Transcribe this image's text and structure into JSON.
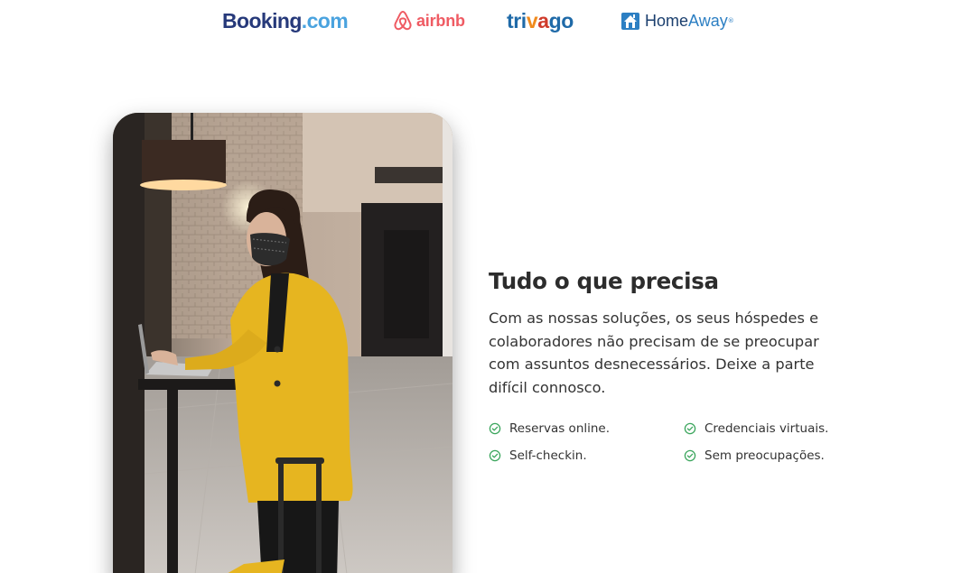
{
  "partners": {
    "booking": {
      "part1": "Booking",
      "part2": ".com"
    },
    "airbnb": {
      "label": "airbnb"
    },
    "trivago": {
      "tri": "tri",
      "v": "v",
      "a": "a",
      "go": "go"
    },
    "homeaway": {
      "part1": "Home",
      "part2": "Away",
      "tm": "®"
    }
  },
  "section": {
    "title": "Tudo o que precisa",
    "description": "Com as nossas soluções, os seus hóspedes e colaboradores não precisam de se preocupar com assuntos desnecessários. Deixe a parte difícil connosco.",
    "features": [
      {
        "label": "Reservas online.",
        "icon": "check-circle-icon"
      },
      {
        "label": "Credenciais virtuais.",
        "icon": "check-circle-icon"
      },
      {
        "label": "Self-checkin.",
        "icon": "check-circle-icon"
      },
      {
        "label": "Sem preocupações.",
        "icon": "check-circle-icon"
      }
    ]
  },
  "colors": {
    "booking_dark": "#26397a",
    "booking_light": "#4aa3df",
    "airbnb": "#ef5b63",
    "trivago_blue": "#1f6aa8",
    "trivago_orange": "#f08b1d",
    "trivago_red": "#cf3b2b",
    "homeaway": "#2c7fc3",
    "check_green": "#3aa55c",
    "title": "#2c2c2c"
  }
}
